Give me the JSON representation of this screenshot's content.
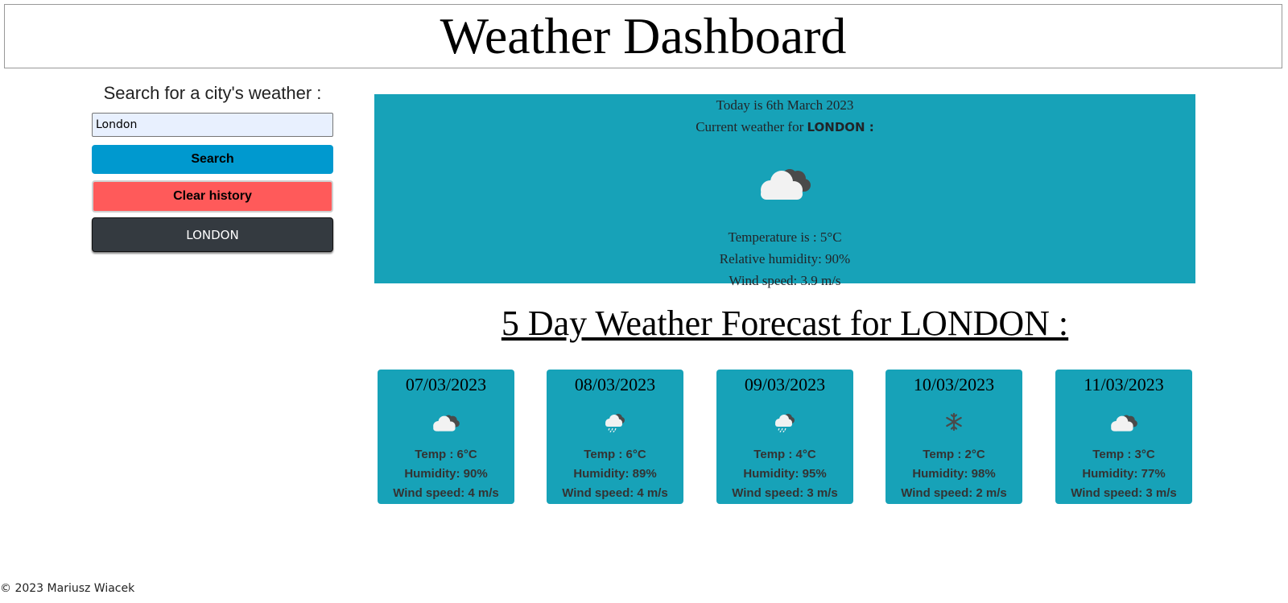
{
  "header": {
    "title": "Weather Dashboard"
  },
  "sidebar": {
    "search_title": "Search for a city's weather :",
    "city_input_value": "London",
    "search_label": "Search",
    "clear_label": "Clear history",
    "history": [
      "LONDON"
    ]
  },
  "current": {
    "date_line": "Today is 6th March 2023",
    "weather_prefix": "Current weather for",
    "city": "LONDON :",
    "icon": "cloudy-icon",
    "temperature": "Temperature is : 5°C",
    "humidity": "Relative humidity: 90%",
    "wind": "Wind speed: 3.9 m/s"
  },
  "forecast": {
    "title": "5 Day Weather Forecast for LONDON :",
    "days": [
      {
        "date": "07/03/2023",
        "icon": "cloudy-icon",
        "temp": "Temp : 6°C",
        "humidity": "Humidity: 90%",
        "wind": "Wind speed: 4 m/s"
      },
      {
        "date": "08/03/2023",
        "icon": "rain-icon",
        "temp": "Temp : 6°C",
        "humidity": "Humidity: 89%",
        "wind": "Wind speed: 4 m/s"
      },
      {
        "date": "09/03/2023",
        "icon": "rain-icon",
        "temp": "Temp : 4°C",
        "humidity": "Humidity: 95%",
        "wind": "Wind speed: 3 m/s"
      },
      {
        "date": "10/03/2023",
        "icon": "snow-icon",
        "temp": "Temp : 2°C",
        "humidity": "Humidity: 98%",
        "wind": "Wind speed: 2 m/s"
      },
      {
        "date": "11/03/2023",
        "icon": "cloudy-icon",
        "temp": "Temp : 3°C",
        "humidity": "Humidity: 77%",
        "wind": "Wind speed: 3 m/s"
      }
    ]
  },
  "footer": {
    "text": "© 2023 Mariusz Wiacek"
  }
}
